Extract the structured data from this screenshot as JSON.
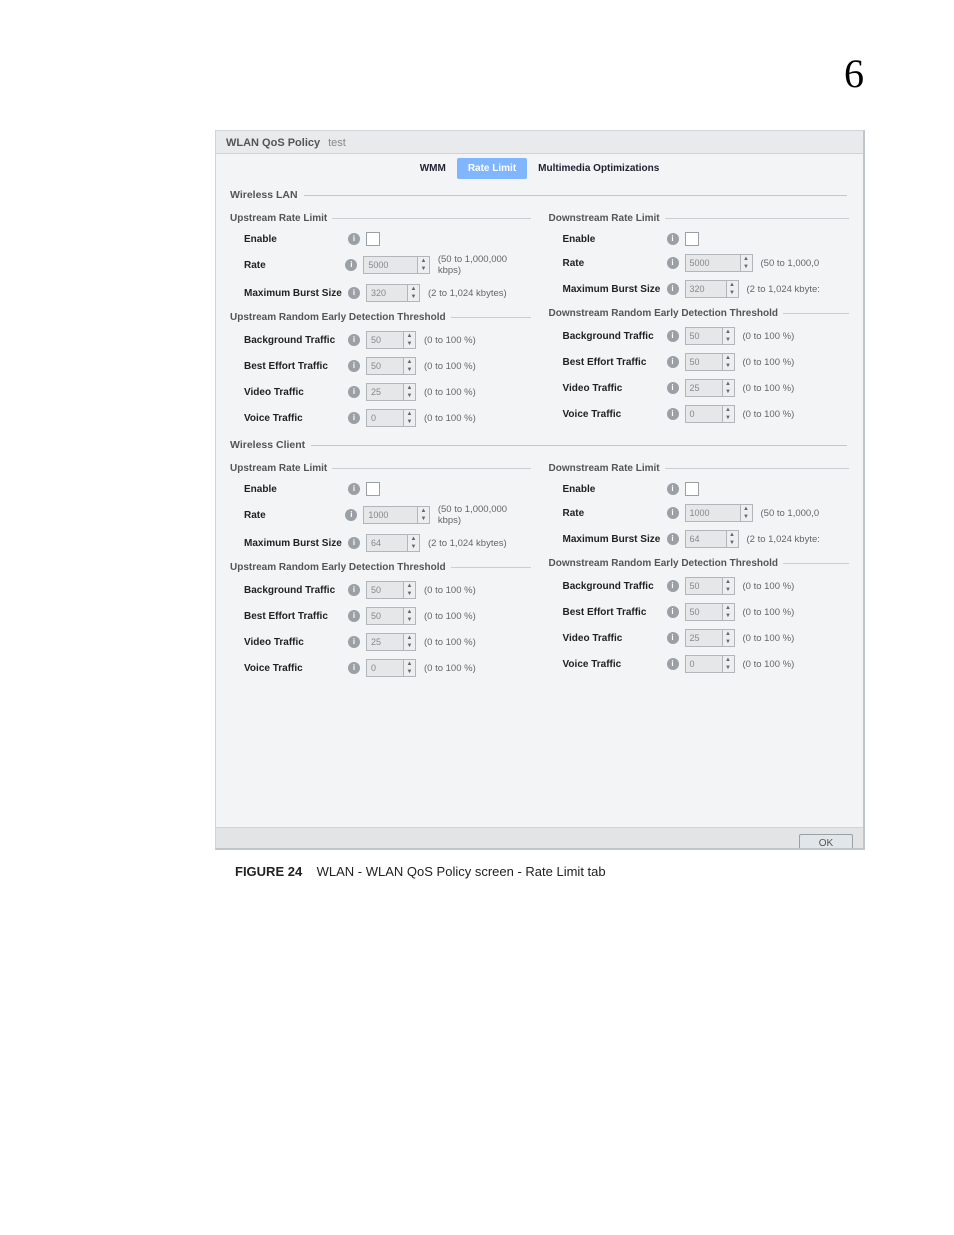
{
  "chapter_number": "6",
  "caption": {
    "figure_label": "FIGURE 24",
    "text": "WLAN - WLAN QoS Policy screen - Rate Limit tab"
  },
  "title": {
    "name": "WLAN QoS Policy",
    "value": "test"
  },
  "tabs": {
    "wmm": "WMM",
    "rate_limit": "Rate Limit",
    "mm_opt": "Multimedia Optimizations"
  },
  "labels": {
    "wireless_lan": "Wireless LAN",
    "wireless_client": "Wireless Client",
    "upstream_rate_limit": "Upstream Rate Limit",
    "downstream_rate_limit": "Downstream Rate Limit",
    "upstream_red": "Upstream Random Early Detection Threshold",
    "downstream_red": "Downstream Random Early Detection Threshold",
    "enable": "Enable",
    "rate": "Rate",
    "max_burst": "Maximum Burst Size",
    "bg_traffic": "Background Traffic",
    "be_traffic": "Best Effort Traffic",
    "video_traffic": "Video Traffic",
    "voice_traffic": "Voice Traffic",
    "ok": "OK"
  },
  "suffix": {
    "rate": "(50 to 1,000,000 kbps)",
    "rate_trunc": "(50 to 1,000,0",
    "burst": "(2 to 1,024 kbytes)",
    "burst_trunc": "(2 to 1,024 kbyte:",
    "pct": "(0 to 100 %)"
  },
  "values": {
    "lan": {
      "rate": "5000",
      "burst": "320",
      "bg": "50",
      "be": "50",
      "video": "25",
      "voice": "0"
    },
    "client": {
      "rate": "1000",
      "burst": "64",
      "bg": "50",
      "be": "50",
      "video": "25",
      "voice": "0"
    }
  },
  "info_glyph": "i"
}
